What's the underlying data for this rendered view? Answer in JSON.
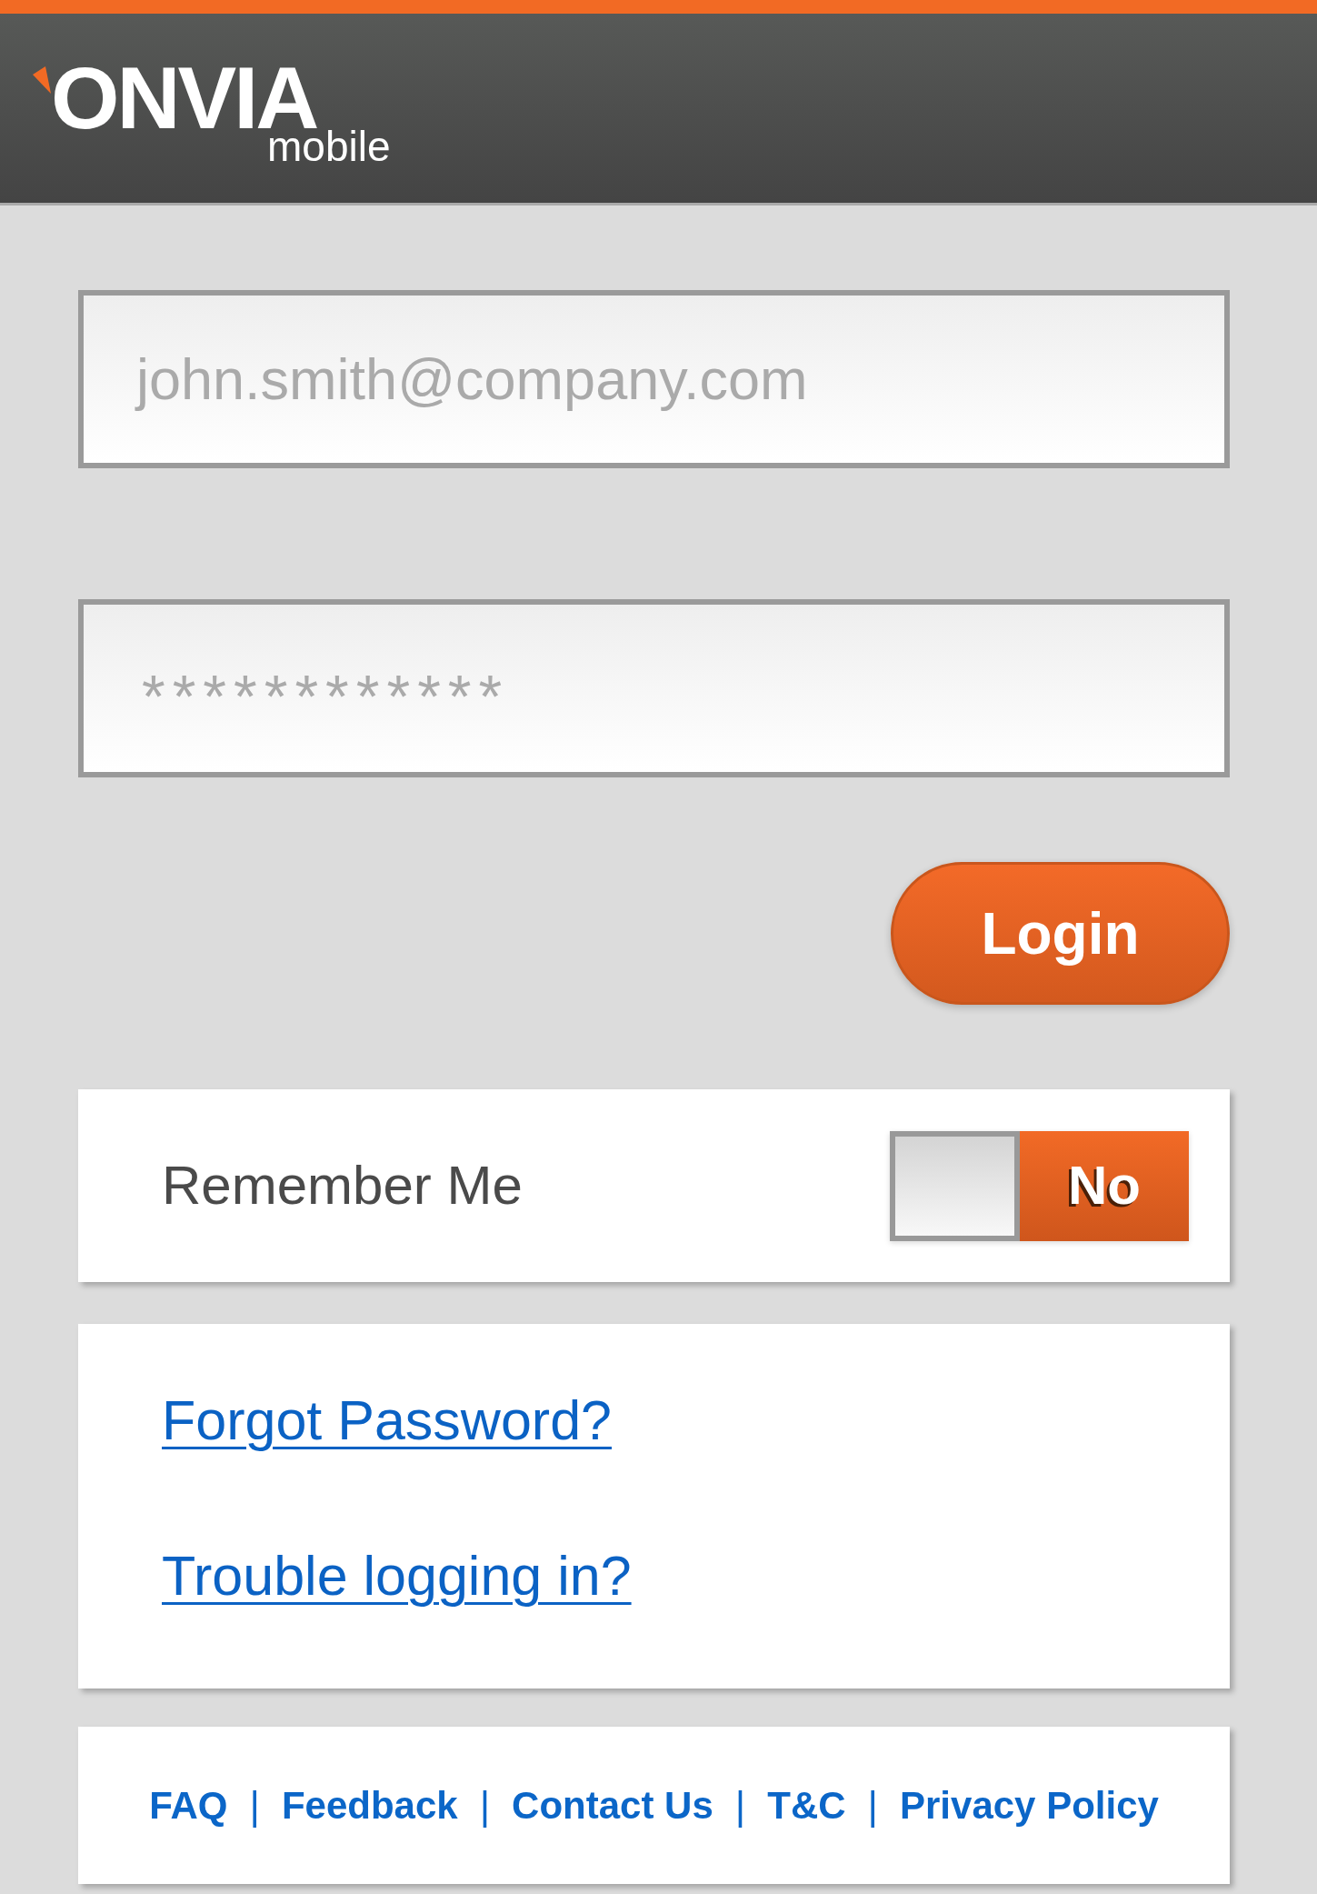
{
  "header": {
    "logo": {
      "wordmark": "ONVIA",
      "subtitle": "mobile"
    }
  },
  "login_form": {
    "email": {
      "placeholder": "john.smith@company.com"
    },
    "password": {
      "placeholder": "************"
    },
    "login_button": "Login"
  },
  "remember_me": {
    "label": "Remember Me",
    "toggle": {
      "on": false,
      "label": "No"
    }
  },
  "help_links": [
    "Forgot Password?",
    "Trouble logging in?"
  ],
  "footer": [
    {
      "kind": "link",
      "label": "FAQ"
    },
    {
      "kind": "separator",
      "label": "|"
    },
    {
      "kind": "link",
      "label": "Feedback"
    },
    {
      "kind": "separator",
      "label": "|"
    },
    {
      "kind": "link",
      "label": "Contact Us"
    },
    {
      "kind": "separator",
      "label": "|"
    },
    {
      "kind": "link",
      "label": "T&C"
    },
    {
      "kind": "separator",
      "label": "|"
    },
    {
      "kind": "link",
      "label": "Privacy Policy"
    }
  ]
}
